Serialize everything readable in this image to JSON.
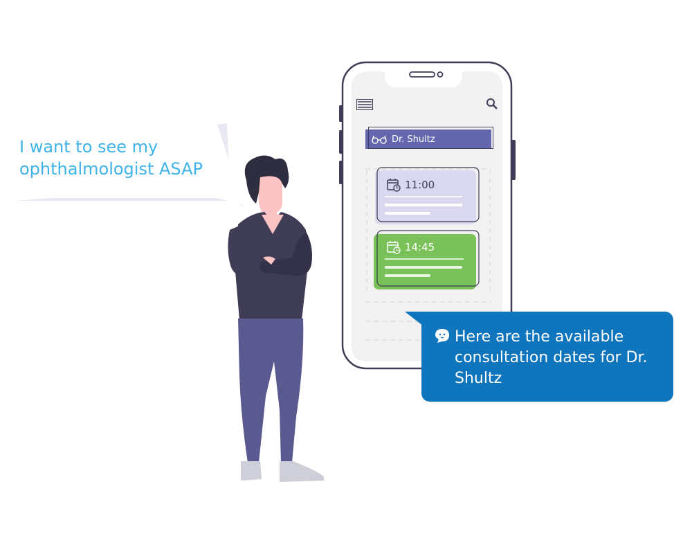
{
  "user_message": {
    "text": "I want to see my ophthalmologist ASAP"
  },
  "phone": {
    "doctor_name": "Dr. Shultz",
    "icons": [
      "menu-icon",
      "search-icon",
      "glasses-icon",
      "calendar-clock-icon"
    ],
    "slots": [
      {
        "time": "11:00",
        "status": "available"
      },
      {
        "time": "14:45",
        "status": "selected"
      }
    ]
  },
  "bot_message": {
    "text": "Here are the available consultation dates for Dr. Shultz",
    "icon": "chatbot-face-icon"
  },
  "colors": {
    "accent_blue": "#3fb3e9",
    "bot_bubble": "#0f75bd",
    "doctor_bar": "#6466ae",
    "slot_lavender": "#d9d8ee",
    "slot_green": "#7ac15a",
    "shirt": "#3f3d56",
    "pants": "#5a5a91"
  }
}
